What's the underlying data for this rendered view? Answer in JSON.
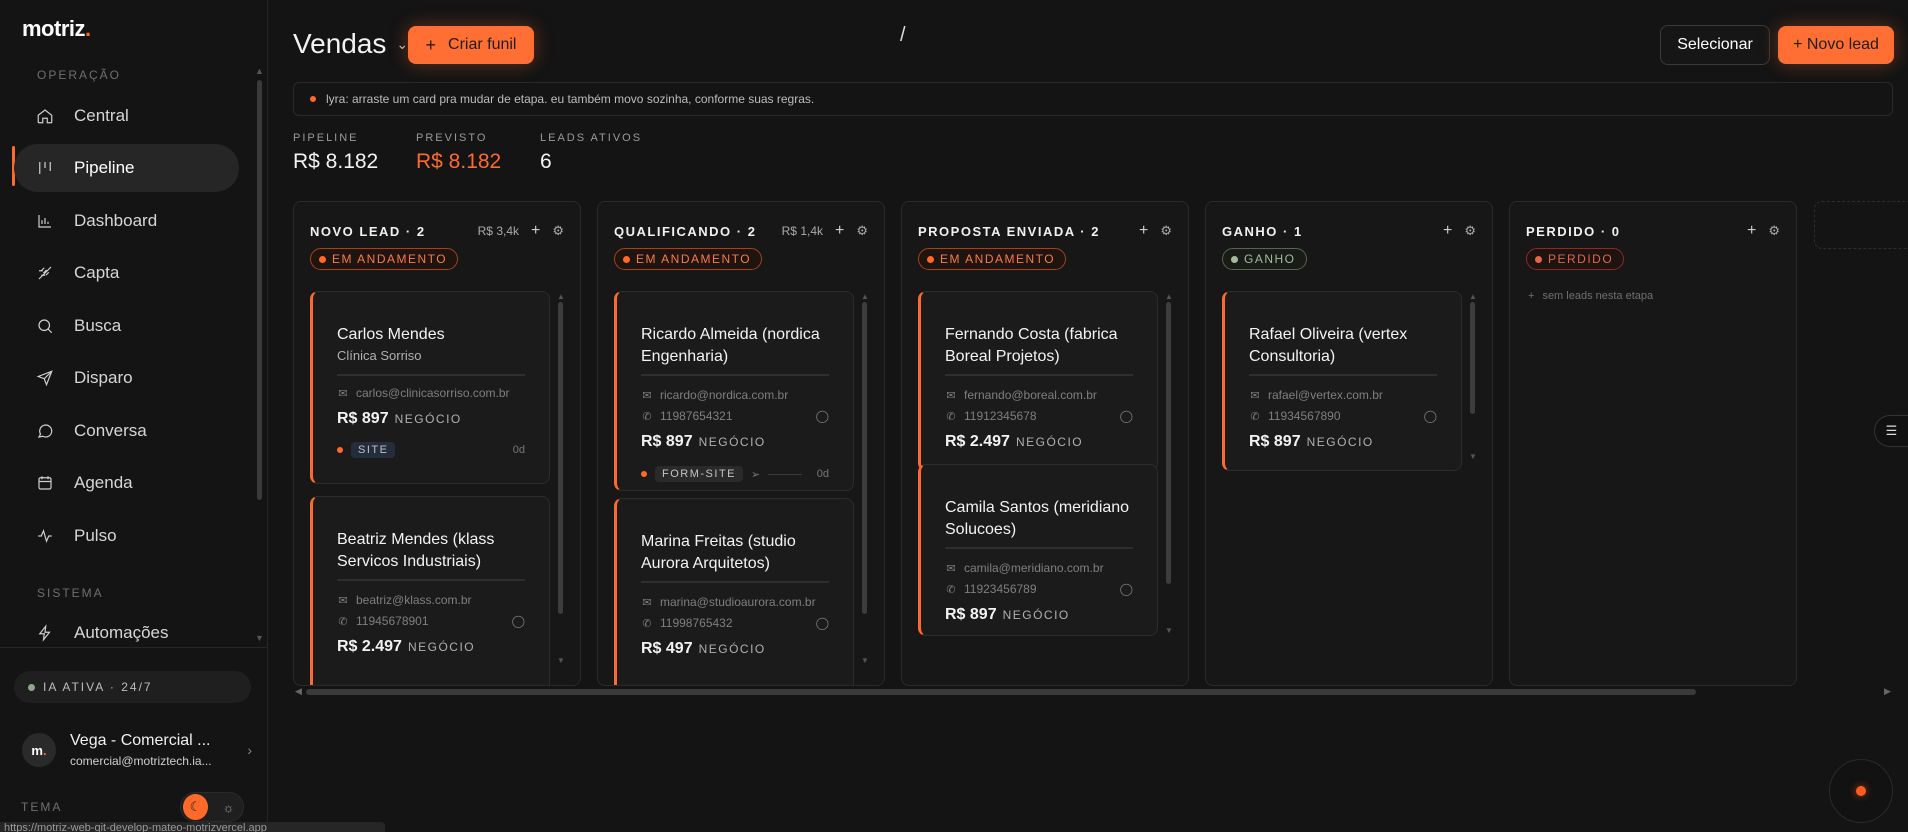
{
  "sidebar": {
    "logo": "motriz",
    "logo_dot": ".",
    "section_operacao": "OPERAÇÃO",
    "section_sistema": "SISTEMA",
    "items": [
      {
        "label": "Central",
        "icon": "home-icon"
      },
      {
        "label": "Pipeline",
        "icon": "pipeline-icon"
      },
      {
        "label": "Dashboard",
        "icon": "bar-chart-icon"
      },
      {
        "label": "Capta",
        "icon": "capture-icon"
      },
      {
        "label": "Busca",
        "icon": "search-icon"
      },
      {
        "label": "Disparo",
        "icon": "send-icon"
      },
      {
        "label": "Conversa",
        "icon": "chat-icon"
      },
      {
        "label": "Agenda",
        "icon": "calendar-icon"
      },
      {
        "label": "Pulso",
        "icon": "pulse-icon"
      },
      {
        "label": "Automações",
        "icon": "lightning-icon"
      }
    ],
    "active_item": "Pipeline",
    "ia_status": "IA ATIVA · 24/7",
    "user": {
      "initials": "m",
      "initials_dot": ".",
      "name": "Vega - Comercial ...",
      "email": "comercial@motriztech.ia..."
    },
    "tema_label": "TEMA",
    "status_url": "https://motriz-web-git-develop-mateo-motrizvercel.app"
  },
  "header": {
    "title": "Vendas",
    "create_funnel": "Criar funil",
    "select": "Selecionar",
    "new_lead": "+ Novo lead",
    "notice": "lyra: arraste um card pra mudar de etapa. eu também movo sozinha, conforme suas regras."
  },
  "stats": [
    {
      "label": "PIPELINE",
      "value": "R$ 8.182"
    },
    {
      "label": "PREVISTO",
      "value": "R$ 8.182"
    },
    {
      "label": "LEADS ATIVOS",
      "value": "6"
    }
  ],
  "colors": {
    "accent": "#ff6a2b",
    "background": "#141414",
    "card": "#1b1b1b",
    "success": "#a7b8a0",
    "danger": "#e4664b"
  },
  "columns": [
    {
      "title": "NOVO LEAD · 2",
      "total": "R$ 3,4k",
      "badge": "EM ANDAMENTO",
      "cards": [
        {
          "name": "Carlos Mendes",
          "company": "Clínica Sorriso",
          "email": "carlos@clinicasorriso.com.br",
          "amount": "R$ 897",
          "amount_label": "NEGÓCIO",
          "tag": "SITE",
          "age": "0d"
        },
        {
          "name": "Beatriz Mendes (klass Servicos Industriais)",
          "email": "beatriz@klass.com.br",
          "phone": "11945678901",
          "amount": "R$ 2.497",
          "amount_label": "NEGÓCIO"
        }
      ]
    },
    {
      "title": "QUALIFICANDO · 2",
      "total": "R$ 1,4k",
      "badge": "EM ANDAMENTO",
      "cards": [
        {
          "name": "Ricardo Almeida (nordica Engenharia)",
          "email": "ricardo@nordica.com.br",
          "phone": "11987654321",
          "amount": "R$ 897",
          "amount_label": "NEGÓCIO",
          "tag": "FORM-SITE",
          "age": "0d"
        },
        {
          "name": "Marina Freitas (studio Aurora Arquitetos)",
          "email": "marina@studioaurora.com.br",
          "phone": "11998765432",
          "amount": "R$ 497",
          "amount_label": "NEGÓCIO"
        }
      ]
    },
    {
      "title": "PROPOSTA ENVIADA · 2",
      "badge": "EM ANDAMENTO",
      "cards": [
        {
          "name": "Fernando Costa (fabrica Boreal Projetos)",
          "email": "fernando@boreal.com.br",
          "phone": "11912345678",
          "amount": "R$ 2.497",
          "amount_label": "NEGÓCIO"
        },
        {
          "name": "Camila Santos (meridiano Solucoes)",
          "email": "camila@meridiano.com.br",
          "phone": "11923456789",
          "amount": "R$ 897",
          "amount_label": "NEGÓCIO"
        }
      ]
    },
    {
      "title": "GANHO · 1",
      "badge": "GANHO",
      "cards": [
        {
          "name": "Rafael Oliveira (vertex Consultoria)",
          "email": "rafael@vertex.com.br",
          "phone": "11934567890",
          "amount": "R$ 897",
          "amount_label": "NEGÓCIO"
        }
      ]
    },
    {
      "title": "PERDIDO · 0",
      "badge": "PERDIDO",
      "empty": "sem leads nesta etapa",
      "cards": []
    }
  ]
}
